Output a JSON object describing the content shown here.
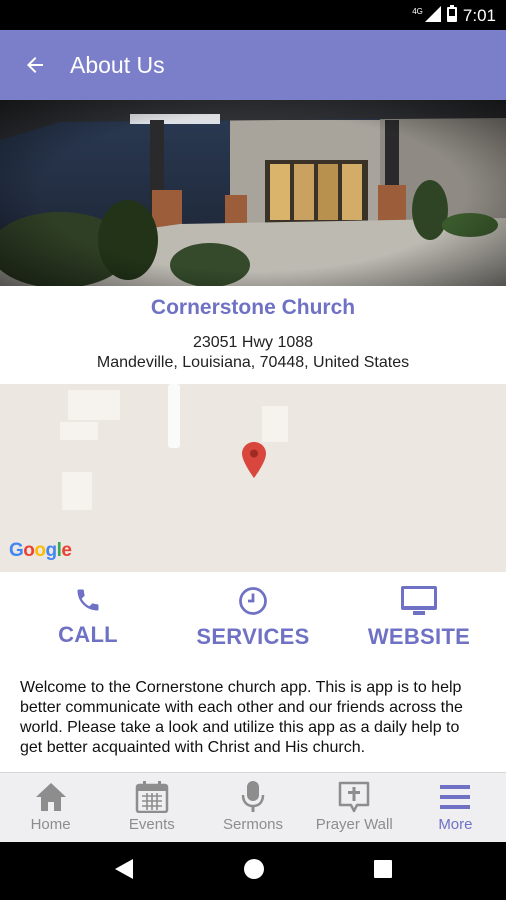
{
  "status_bar": {
    "network": "4G",
    "time": "7:01",
    "icons": [
      "signal-icon",
      "battery-icon"
    ]
  },
  "app_bar": {
    "title": "About Us",
    "back_icon": "arrow-left-icon"
  },
  "hero": {
    "description": "church building exterior"
  },
  "church": {
    "name": "Cornerstone Church",
    "address_line1": "23051 Hwy 1088",
    "address_line2": "Mandeville, Louisiana, 70448, United States"
  },
  "map": {
    "attribution": "Google",
    "marker_icon": "map-pin-icon"
  },
  "actions": [
    {
      "label": "CALL",
      "icon": "phone-icon"
    },
    {
      "label": "SERVICES",
      "icon": "clock-icon"
    },
    {
      "label": "WEBSITE",
      "icon": "monitor-icon"
    }
  ],
  "welcome_text": "Welcome to the Cornerstone church app.  This is app is to help better communicate with each other and our friends across the world.  Please take a look and utilize this app as a daily help to get better acquainted with Christ and His church.",
  "bottom_nav": [
    {
      "label": "Home",
      "icon": "home-icon",
      "active": false
    },
    {
      "label": "Events",
      "icon": "calendar-icon",
      "active": false
    },
    {
      "label": "Sermons",
      "icon": "microphone-icon",
      "active": false
    },
    {
      "label": "Prayer Wall",
      "icon": "prayer-cross-icon",
      "active": false
    },
    {
      "label": "More",
      "icon": "menu-icon",
      "active": true
    }
  ],
  "colors": {
    "primary": "#7b7fc9",
    "accent": "#6f72c4",
    "pin": "#d9463d"
  }
}
